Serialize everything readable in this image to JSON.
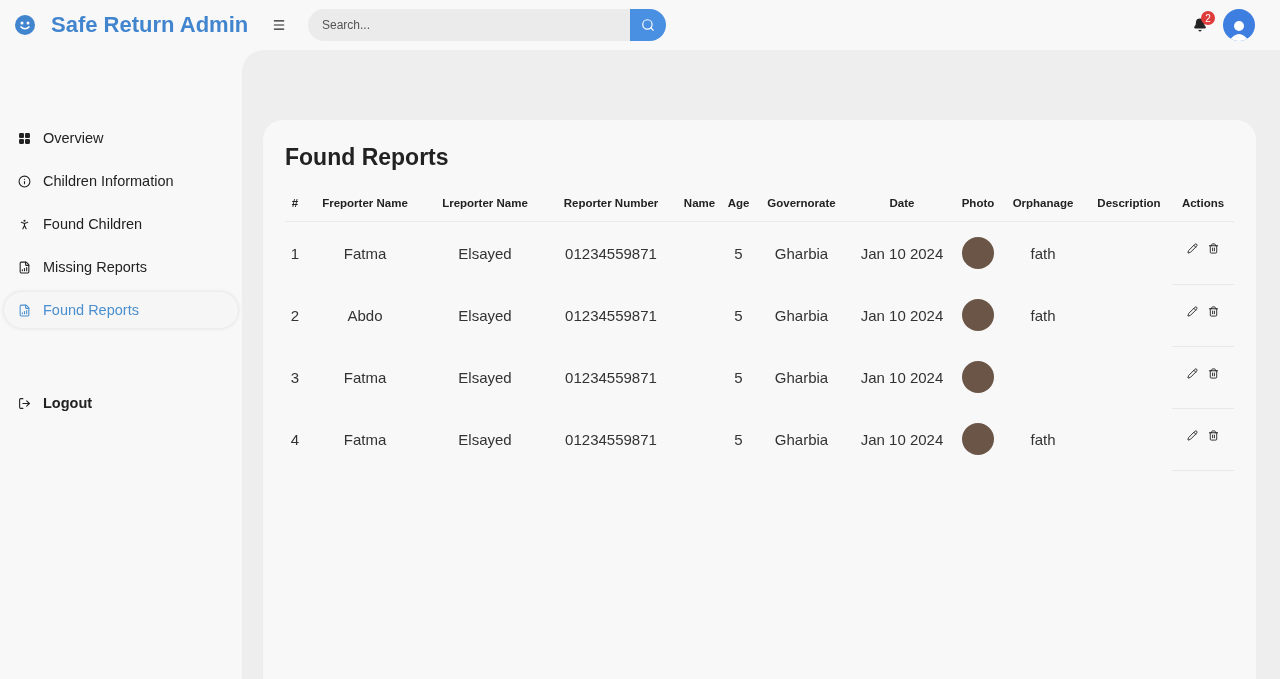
{
  "header": {
    "title": "Safe Return Admin",
    "search": {
      "placeholder": "Search..."
    },
    "notifications": {
      "count": "2"
    }
  },
  "sidebar": {
    "items": [
      {
        "label": "Overview",
        "kind": "grid",
        "selected": false
      },
      {
        "label": "Children Information",
        "kind": "info",
        "selected": false
      },
      {
        "label": "Found Children",
        "kind": "person",
        "selected": false
      },
      {
        "label": "Missing Reports",
        "kind": "report",
        "selected": false
      },
      {
        "label": "Found Reports",
        "kind": "report",
        "selected": true
      }
    ],
    "logout": {
      "label": "Logout"
    }
  },
  "page": {
    "title": "Found Reports"
  },
  "table": {
    "columns": [
      "#",
      "Freporter Name",
      "Lreporter Name",
      "Reporter Number",
      "Name",
      "Age",
      "Governorate",
      "Date",
      "Photo",
      "Orphanage",
      "Description",
      "Actions"
    ],
    "rows": [
      {
        "index": "1",
        "freporter": "Fatma",
        "lreporter": "Elsayed",
        "number": "01234559871",
        "age": "5",
        "governorate": "Gharbia",
        "date": "Jan 10 2024",
        "orphanage": "fath"
      },
      {
        "index": "2",
        "freporter": "Abdo",
        "lreporter": "Elsayed",
        "number": "01234559871",
        "age": "5",
        "governorate": "Gharbia",
        "date": "Jan 10 2024",
        "orphanage": "fath"
      },
      {
        "index": "3",
        "freporter": "Fatma",
        "lreporter": "Elsayed",
        "number": "01234559871",
        "age": "5",
        "governorate": "Gharbia",
        "date": "Jan 10 2024"
      },
      {
        "index": "4",
        "freporter": "Fatma",
        "lreporter": "Elsayed",
        "number": "01234559871",
        "age": "5",
        "governorate": "Gharbia",
        "date": "Jan 10 2024",
        "orphanage": "fath"
      }
    ]
  }
}
